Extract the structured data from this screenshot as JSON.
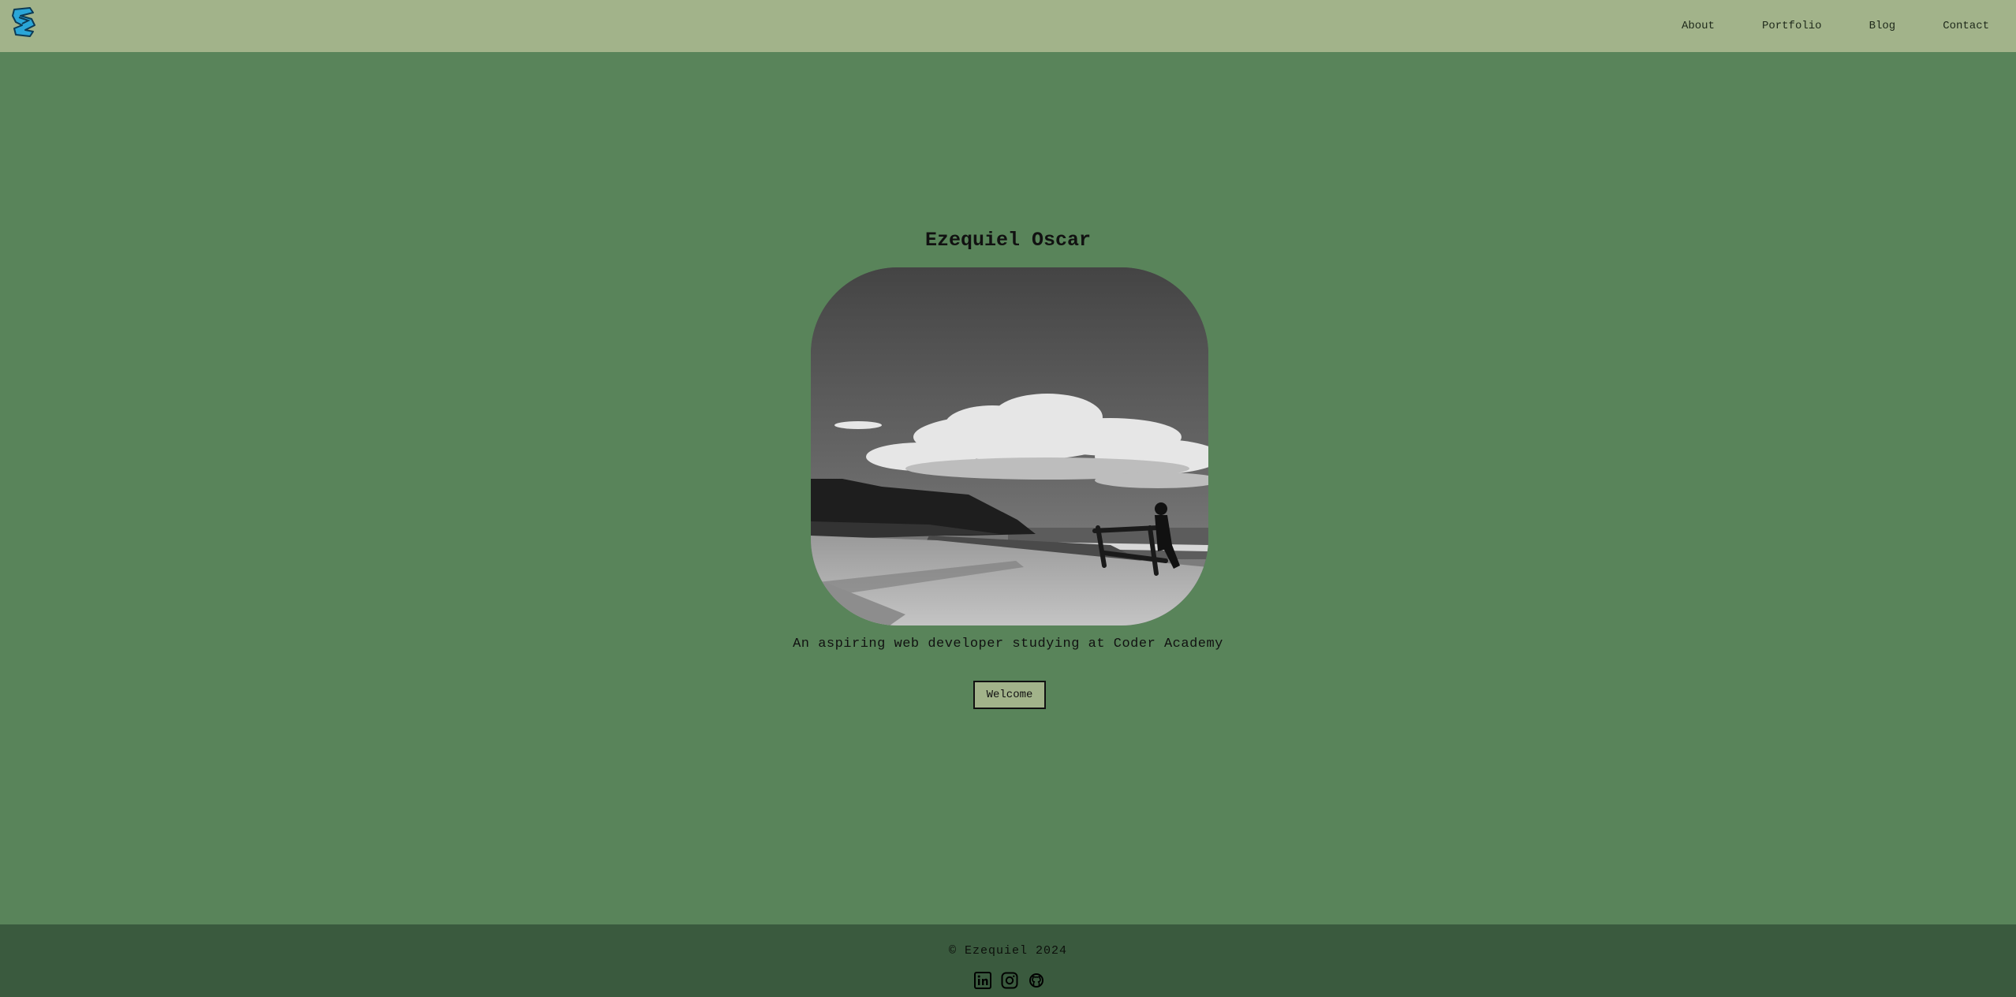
{
  "header": {
    "logo": "logo-icon",
    "nav": [
      {
        "label": "About"
      },
      {
        "label": "Portfolio"
      },
      {
        "label": "Blog"
      },
      {
        "label": "Contact"
      }
    ]
  },
  "hero": {
    "name": "Ezequiel Oscar",
    "photo": "black-and-white coastal landscape photo",
    "tagline": "An aspiring web developer studying at Coder Academy",
    "button_label": "Welcome"
  },
  "footer": {
    "copyright": "© Ezequiel 2024",
    "socials": [
      {
        "icon": "linkedin-icon"
      },
      {
        "icon": "instagram-icon"
      },
      {
        "icon": "github-icon"
      }
    ]
  },
  "colors": {
    "header_bg": "#a2b38a",
    "page_bg": "#59845a",
    "footer_bg": "#3a5a3e",
    "button_bg": "#a2b38a",
    "logo_accent": "#2aa6d8"
  }
}
